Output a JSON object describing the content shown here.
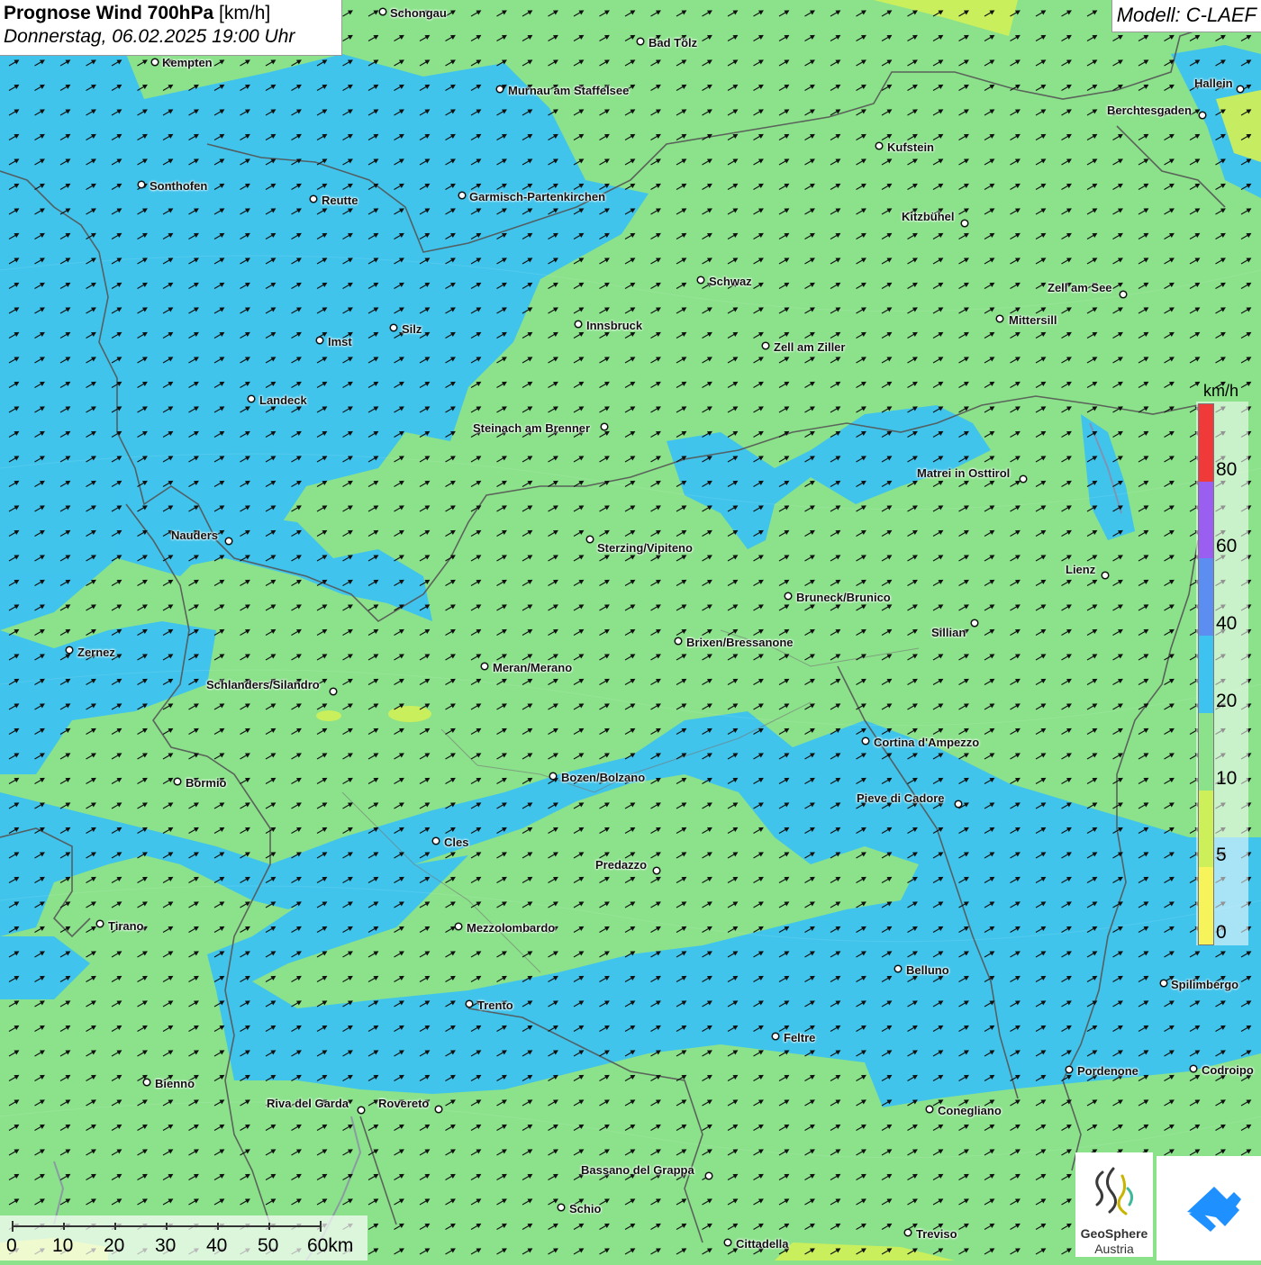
{
  "header": {
    "title_bold": "Prognose Wind 700hPa",
    "title_unit": "[km/h]",
    "datetime": "Donnerstag, 06.02.2025 19:00 Uhr",
    "model": "Modell: C-LAEF"
  },
  "legend": {
    "unit": "km/h",
    "steps": [
      {
        "label": "0",
        "color": "#f7f35a"
      },
      {
        "label": "5",
        "color": "#cdef5a"
      },
      {
        "label": "10",
        "color": "#8be28b"
      },
      {
        "label": "20",
        "color": "#3ec3f0"
      },
      {
        "label": "40",
        "color": "#5b8ef0"
      },
      {
        "label": "60",
        "color": "#9a5ef0"
      },
      {
        "label": "80",
        "color": "#f03a3a"
      }
    ]
  },
  "scale_bar": {
    "labels": [
      "0",
      "10",
      "20",
      "30",
      "40",
      "50",
      "60km"
    ]
  },
  "cities": [
    {
      "name": "Schongau"
    },
    {
      "name": "Bad Tölz"
    },
    {
      "name": "Kempten"
    },
    {
      "name": "Murnau am Staffelsee"
    },
    {
      "name": "Hallein"
    },
    {
      "name": "Berchtesgaden"
    },
    {
      "name": "Kufstein"
    },
    {
      "name": "Sonthofen"
    },
    {
      "name": "Reutte"
    },
    {
      "name": "Garmisch-Partenkirchen"
    },
    {
      "name": "Kitzbühel"
    },
    {
      "name": "Schwaz"
    },
    {
      "name": "Zell am See"
    },
    {
      "name": "Mittersill"
    },
    {
      "name": "Innsbruck"
    },
    {
      "name": "Silz"
    },
    {
      "name": "Imst"
    },
    {
      "name": "Zell am Ziller"
    },
    {
      "name": "Landeck"
    },
    {
      "name": "Steinach am Brenner"
    },
    {
      "name": "Matrei in Osttirol"
    },
    {
      "name": "Nauders"
    },
    {
      "name": "Sterzing/Vipiteno"
    },
    {
      "name": "Lienz"
    },
    {
      "name": "Bruneck/Brunico"
    },
    {
      "name": "Sillian"
    },
    {
      "name": "Brixen/Bressanone"
    },
    {
      "name": "Zernez"
    },
    {
      "name": "Meran/Merano"
    },
    {
      "name": "Schlanders/Silandro"
    },
    {
      "name": "Cortina d'Ampezzo"
    },
    {
      "name": "Bozen/Bolzano"
    },
    {
      "name": "Bormio"
    },
    {
      "name": "Pieve di Cadore"
    },
    {
      "name": "Cles"
    },
    {
      "name": "Predazzo"
    },
    {
      "name": "Tirano"
    },
    {
      "name": "Mezzolombardo"
    },
    {
      "name": "Belluno"
    },
    {
      "name": "Spilimbergo"
    },
    {
      "name": "Trento"
    },
    {
      "name": "Feltre"
    },
    {
      "name": "Pordenone"
    },
    {
      "name": "Codroipo"
    },
    {
      "name": "Bienno"
    },
    {
      "name": "Riva del Garda"
    },
    {
      "name": "Rovereto"
    },
    {
      "name": "Conegliano"
    },
    {
      "name": "Bassano del Grappa"
    },
    {
      "name": "Schio"
    },
    {
      "name": "Treviso"
    },
    {
      "name": "Cittadella"
    }
  ],
  "logos": {
    "geosphere_name": "GeoSphere",
    "geosphere_sub": "Austria"
  },
  "colors": {
    "wind_10_20": "#8be28b",
    "wind_20_40": "#3ec3f0",
    "wind_5_10": "#cdef5a",
    "borders": "#555555",
    "arrows": "#111111"
  }
}
